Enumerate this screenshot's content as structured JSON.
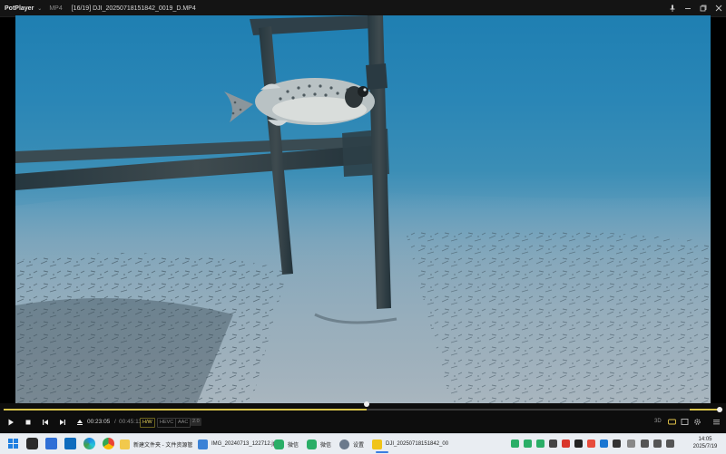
{
  "window": {
    "app_name": "PotPlayer",
    "menu_chevron": "⌄",
    "format": "MP4",
    "file_title": "[16/19] DJI_20250718151842_0019_D.MP4",
    "controls": [
      "pin-icon",
      "minimize-icon",
      "restore-icon",
      "close-icon"
    ]
  },
  "video": {
    "content": "underwater scene with pufferfish and wooden frame",
    "colors": {
      "water_top": "#1f7fb2",
      "seabed": "#8aa6b6"
    }
  },
  "player": {
    "progress": 0.505,
    "volume": 1.0,
    "time_current": "00:23:05",
    "time_separator": "/",
    "time_total": "00:45:11",
    "badges": {
      "hw": "H/W",
      "codec": "HEVC",
      "audio": "AAC",
      "channels": "2.0"
    },
    "mode_3d": "3D",
    "accent_color": "#d8c34a",
    "buttons": [
      "play-icon",
      "stop-icon",
      "previous-icon",
      "next-icon",
      "eject-icon"
    ]
  },
  "taskbar": {
    "apps": [
      {
        "label": "新建文件夹 - 文件资源管",
        "icon": "folder-icon"
      },
      {
        "label": "IMG_20240713_122712.jp",
        "icon": "photos-icon"
      },
      {
        "label": "微信",
        "icon": "wechat-icon"
      },
      {
        "label": "微信",
        "icon": "wechat-icon"
      },
      {
        "label": "设置",
        "icon": "settings-icon"
      },
      {
        "label": "DJI_20250718151842_00",
        "icon": "potplayer-icon"
      }
    ],
    "clock_time": "14:05",
    "clock_date": "2025/7/19"
  }
}
